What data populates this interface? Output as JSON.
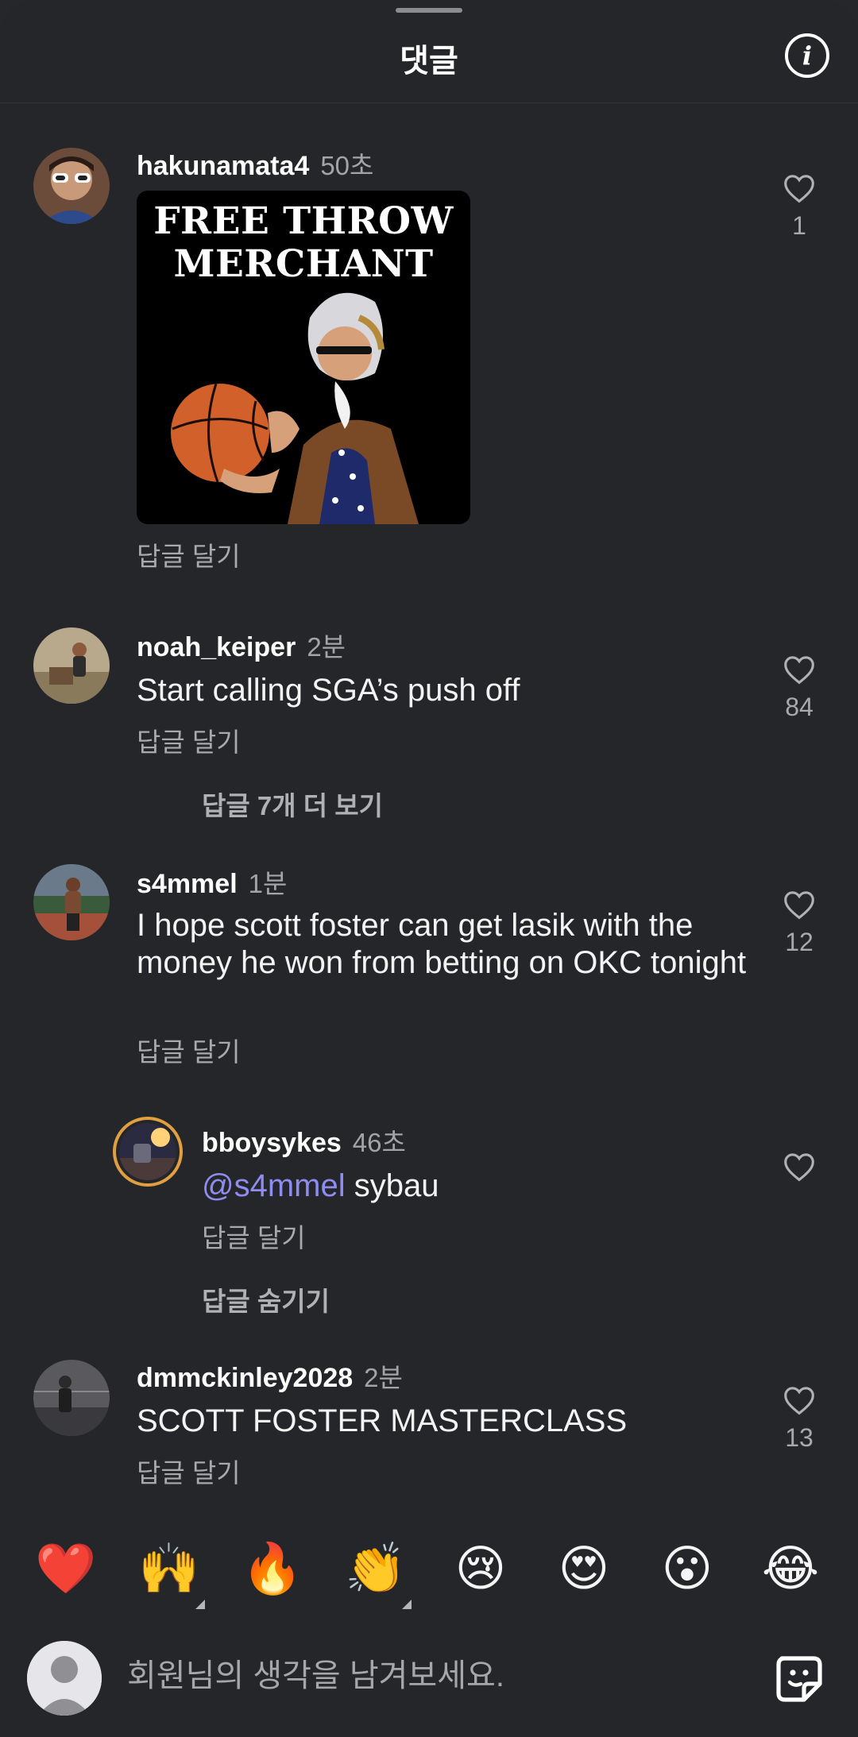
{
  "header": {
    "title": "댓글"
  },
  "comments": [
    {
      "username": "hakunamata4",
      "time": "50초",
      "gif_text": "FREE THROW\nMERCHANT",
      "reply_label": "답글 달기",
      "likes": "1"
    },
    {
      "username": "noah_keiper",
      "time": "2분",
      "text": "Start calling SGA’s push off",
      "reply_label": "답글 달기",
      "likes": "84",
      "more_replies": "답글 7개 더 보기"
    },
    {
      "username": "s4mmel",
      "time": "1분",
      "text": "I hope scott foster can get lasik with the money he won from betting on OKC tonight",
      "reply_label": "답글 달기",
      "likes": "12"
    },
    {
      "username": "bboysykes",
      "time": "46초",
      "mention": "@s4mmel",
      "text": " sybau",
      "reply_label": "답글 달기",
      "hide_replies": "답글 숨기기"
    },
    {
      "username": "dmmckinley2028",
      "time": "2분",
      "text": "SCOTT FOSTER MASTERCLASS",
      "reply_label": "답글 달기",
      "likes": "13"
    }
  ],
  "reactions": [
    "❤️",
    "🙌",
    "🔥",
    "👏",
    "😢",
    "😍",
    "😮",
    "😂"
  ],
  "composer": {
    "placeholder": "회원님의 생각을 남겨보세요."
  },
  "colors": {
    "background": "#25262a",
    "mention": "#8f8cf0",
    "muted": "#a8a9ad"
  },
  "icons": {
    "like": "heart-outline-icon",
    "info": "info-icon",
    "sticker": "sticker-icon"
  }
}
